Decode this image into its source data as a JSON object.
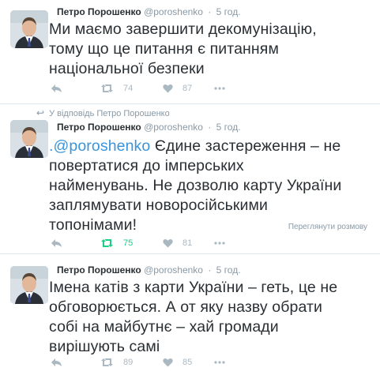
{
  "colors": {
    "text": "#292f33",
    "muted": "#8899a6",
    "mention": "#3b94d9",
    "retweeted": "#19cf86",
    "icon": "#aab8c2",
    "divider": "#e1e8ed"
  },
  "tweets": [
    {
      "name": "Петро Порошенко",
      "handle": "@poroshenko",
      "time": "5 год.",
      "lines": [
        "Ми маємо завершити декомунізацію,",
        "тому що це питання є питанням",
        "національної безпеки"
      ],
      "retweets": "74",
      "likes": "87"
    },
    {
      "context": "У відповідь Петро Порошенко",
      "name": "Петро Порошенко",
      "handle": "@poroshenko",
      "time": "5 год.",
      "mention": ".@poroshenko",
      "lines": [
        " Єдине застереження – не",
        "повертатися до імперських",
        "найменувань. Не дозволю карту України",
        "заплямувати новоросійськими",
        "топонімами!"
      ],
      "retweets": "75",
      "likes": "81",
      "conversation_link": "Переглянути розмову"
    },
    {
      "name": "Петро Порошенко",
      "handle": "@poroshenko",
      "time": "5 год.",
      "lines": [
        "Імена катів з карти України – геть, це не",
        "обговорюється. А от яку назву обрати",
        "собі на майбутнє – хай громади",
        "вирішують самі"
      ],
      "retweets": "89",
      "likes": "85"
    }
  ],
  "icons": {
    "reply": "reply-icon",
    "retweet": "retweet-icon",
    "like": "heart-icon",
    "more": "more-dots-icon",
    "context": "reply-arrow-icon"
  }
}
